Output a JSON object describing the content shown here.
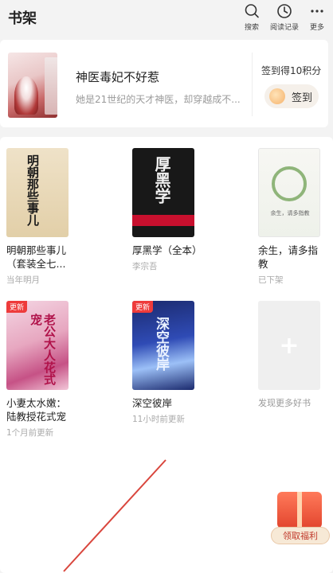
{
  "header": {
    "title": "书架",
    "actions": [
      {
        "label": "搜索",
        "icon": "search-icon"
      },
      {
        "label": "阅读记录",
        "icon": "clock-icon"
      },
      {
        "label": "更多",
        "icon": "more-icon"
      }
    ]
  },
  "recommendation": {
    "title": "神医毒妃不好惹",
    "description": "她是21世纪的天才神医，却穿越成不...",
    "signin_hint": "签到得10积分",
    "signin_button": "签到"
  },
  "books": [
    {
      "name": "明朝那些事儿（套装全七...",
      "meta": "当年明月",
      "cover_text": "明朝那些事儿",
      "badge": ""
    },
    {
      "name": "厚黑学（全本）",
      "meta": "李宗吾",
      "cover_text": "厚黑学",
      "badge": ""
    },
    {
      "name": "余生，请多指教",
      "meta": "已下架",
      "cover_text": "余生，请多指教",
      "badge": ""
    },
    {
      "name": "小妻太水嫩：陆教授花式宠",
      "meta": "1个月前更新",
      "cover_text": "老公大人花式宠",
      "badge": "更新"
    },
    {
      "name": "深空彼岸",
      "meta": "11小时前更新",
      "cover_text": "深空彼岸",
      "badge": "更新"
    }
  ],
  "add_more": {
    "label": "发现更多好书",
    "icon": "plus-icon"
  },
  "gift": {
    "label": "领取福利",
    "icon": "gift-icon"
  }
}
